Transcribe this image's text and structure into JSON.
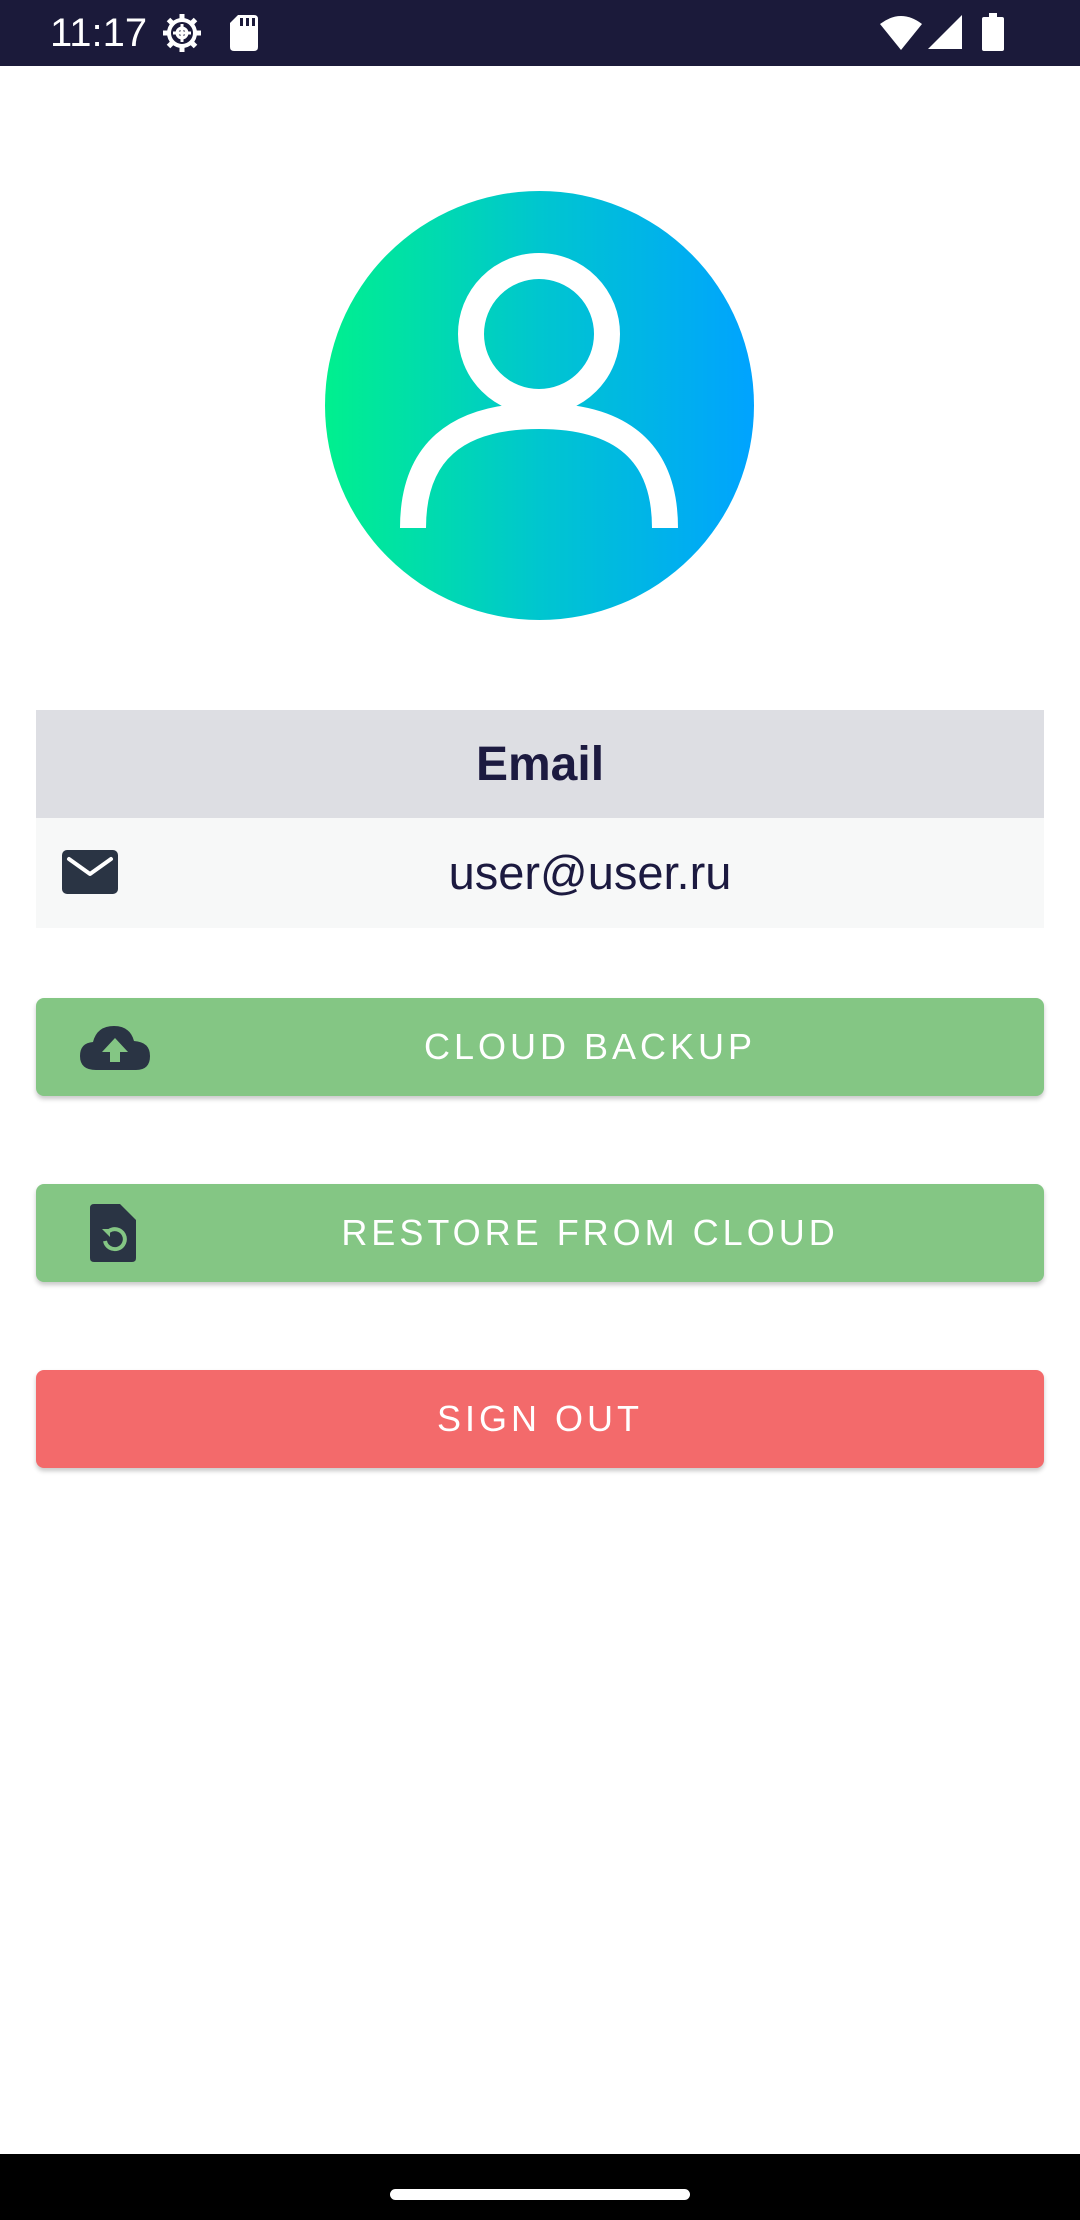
{
  "status_bar": {
    "time": "11:17",
    "icons": [
      "gear-icon",
      "sd-card-icon",
      "wifi-icon",
      "signal-icon",
      "battery-icon"
    ]
  },
  "avatar": {
    "icon": "user-icon",
    "gradient_colors": [
      "#00f08e",
      "#00c6cf",
      "#00a3ff"
    ]
  },
  "email_card": {
    "header": "Email",
    "icon": "mail-icon",
    "value": "user@user.ru"
  },
  "buttons": {
    "cloud_backup": {
      "label": "CLOUD BACKUP",
      "icon": "cloud-upload-icon",
      "color": "#84c684"
    },
    "restore": {
      "label": "RESTORE FROM CLOUD",
      "icon": "file-restore-icon",
      "color": "#84c684"
    },
    "sign_out": {
      "label": "SIGN OUT",
      "color": "#f36a6b"
    }
  },
  "colors": {
    "status_bar": "#1b1a3a",
    "text_dark": "#1c1a40",
    "email_header_bg": "#dddee3",
    "email_row_bg": "#f7f8f8"
  }
}
